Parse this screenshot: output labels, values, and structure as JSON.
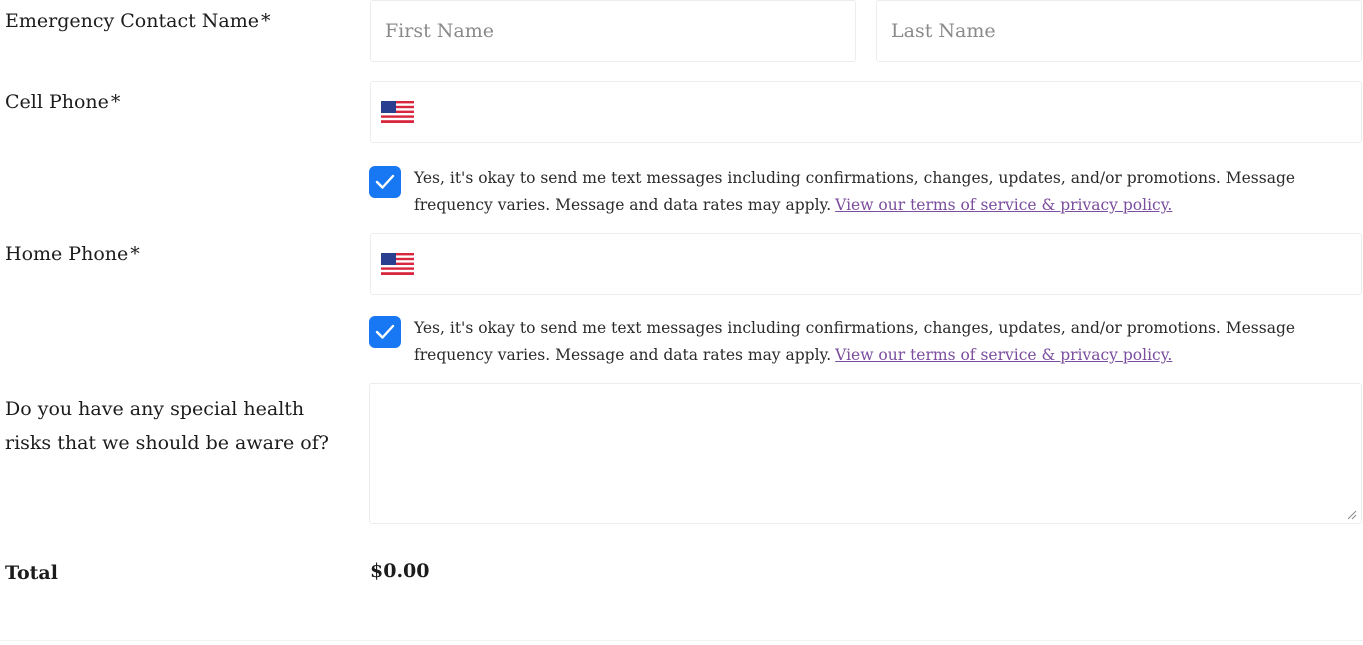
{
  "emergency_contact": {
    "label": "Emergency Contact Name",
    "required_mark": "*",
    "first_name_placeholder": "First Name",
    "last_name_placeholder": "Last Name"
  },
  "cell_phone": {
    "label": "Cell Phone",
    "required_mark": "*",
    "country_flag_icon": "us-flag-icon",
    "sms_consent_checked": true,
    "consent_text": "Yes, it's okay to send me text messages including confirmations, changes, updates, and/or promotions. Message frequency varies. Message and data rates may apply.",
    "consent_link": "View our terms of service & privacy policy."
  },
  "home_phone": {
    "label": "Home Phone",
    "required_mark": "*",
    "country_flag_icon": "us-flag-icon",
    "sms_consent_checked": true,
    "consent_text": "Yes, it's okay to send me text messages including confirmations, changes, updates, and/or promotions. Message frequency varies. Message and data rates may apply.",
    "consent_link": "View our terms of service & privacy policy."
  },
  "health_risks": {
    "label": "Do you have any special health risks that we should be aware of?"
  },
  "total": {
    "label": "Total",
    "value": "$0.00"
  },
  "colors": {
    "checkbox": "#1877f2",
    "link": "#7b4d9e",
    "border": "#ececec"
  }
}
